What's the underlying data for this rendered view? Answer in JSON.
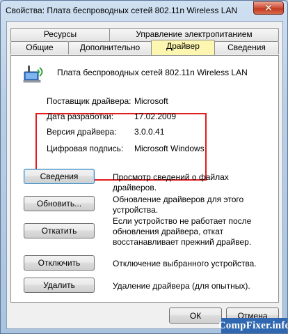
{
  "window": {
    "title": "Свойства: Плата беспроводных сетей 802.11n Wireless LAN",
    "close_glyph": "✕"
  },
  "tabs_top": [
    {
      "label": "Ресурсы"
    },
    {
      "label": "Управление электропитанием"
    }
  ],
  "tabs_bottom": [
    {
      "label": "Общие"
    },
    {
      "label": "Дополнительно"
    },
    {
      "label": "Драйвер",
      "active": true
    },
    {
      "label": "Сведения"
    }
  ],
  "device": {
    "name": "Плата беспроводных сетей 802.11n Wireless LAN",
    "icon": "network-adapter-icon"
  },
  "driver_info": [
    {
      "label": "Поставщик драйвера:",
      "value": "Microsoft"
    },
    {
      "label": "Дата разработки:",
      "value": "17.02.2009"
    },
    {
      "label": "Версия драйвера:",
      "value": "3.0.0.41"
    },
    {
      "label": "Цифровая подпись:",
      "value": "Microsoft Windows"
    }
  ],
  "actions": [
    {
      "label": "Сведения",
      "description": "Просмотр сведений о файлах драйверов."
    },
    {
      "label": "Обновить...",
      "description": "Обновление драйверов для этого устройства."
    },
    {
      "label": "Откатить",
      "description": "Если устройство не работает после обновления драйвера, откат восстанавливает прежний драйвер."
    },
    {
      "label": "Отключить",
      "description": "Отключение выбранного устройства."
    },
    {
      "label": "Удалить",
      "description": "Удаление драйвера (для опытных)."
    }
  ],
  "footer": {
    "ok_label": "ОК",
    "cancel_label": "Отмена"
  },
  "watermark": "CompFixer.info",
  "colors": {
    "highlight_border": "#e21b1b",
    "active_tab": "#fdf6b0",
    "watermark_bg": "#2f67b0"
  }
}
